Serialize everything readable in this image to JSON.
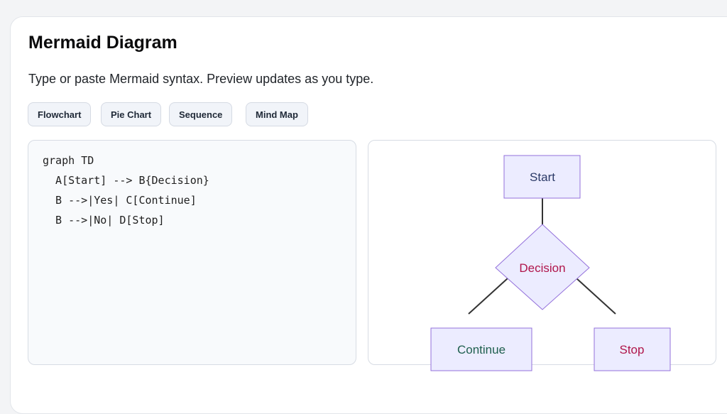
{
  "page": {
    "title": "Mermaid Diagram",
    "subtitle": "Type or paste Mermaid syntax. Preview updates as you type."
  },
  "templates": [
    {
      "label": "Flowchart"
    },
    {
      "label": "Pie Chart"
    },
    {
      "label": "Sequence"
    },
    {
      "label": "Mind Map"
    }
  ],
  "editor": {
    "value": "graph TD\n  A[Start] --> B{Decision}\n  B -->|Yes| C[Continue]\n  B -->|No| D[Stop]"
  },
  "diagram": {
    "nodes": {
      "start": {
        "label": "Start"
      },
      "decision": {
        "label": "Decision"
      },
      "continue": {
        "label": "Continue"
      },
      "stop": {
        "label": "Stop"
      }
    },
    "colors": {
      "node_fill": "#ECECFF",
      "node_stroke": "#9370DB",
      "edge": "#333333",
      "start_text": "#2B3A67",
      "decision_text": "#B0154B",
      "continue_text": "#1F5F4E",
      "stop_text": "#B0154B"
    }
  }
}
